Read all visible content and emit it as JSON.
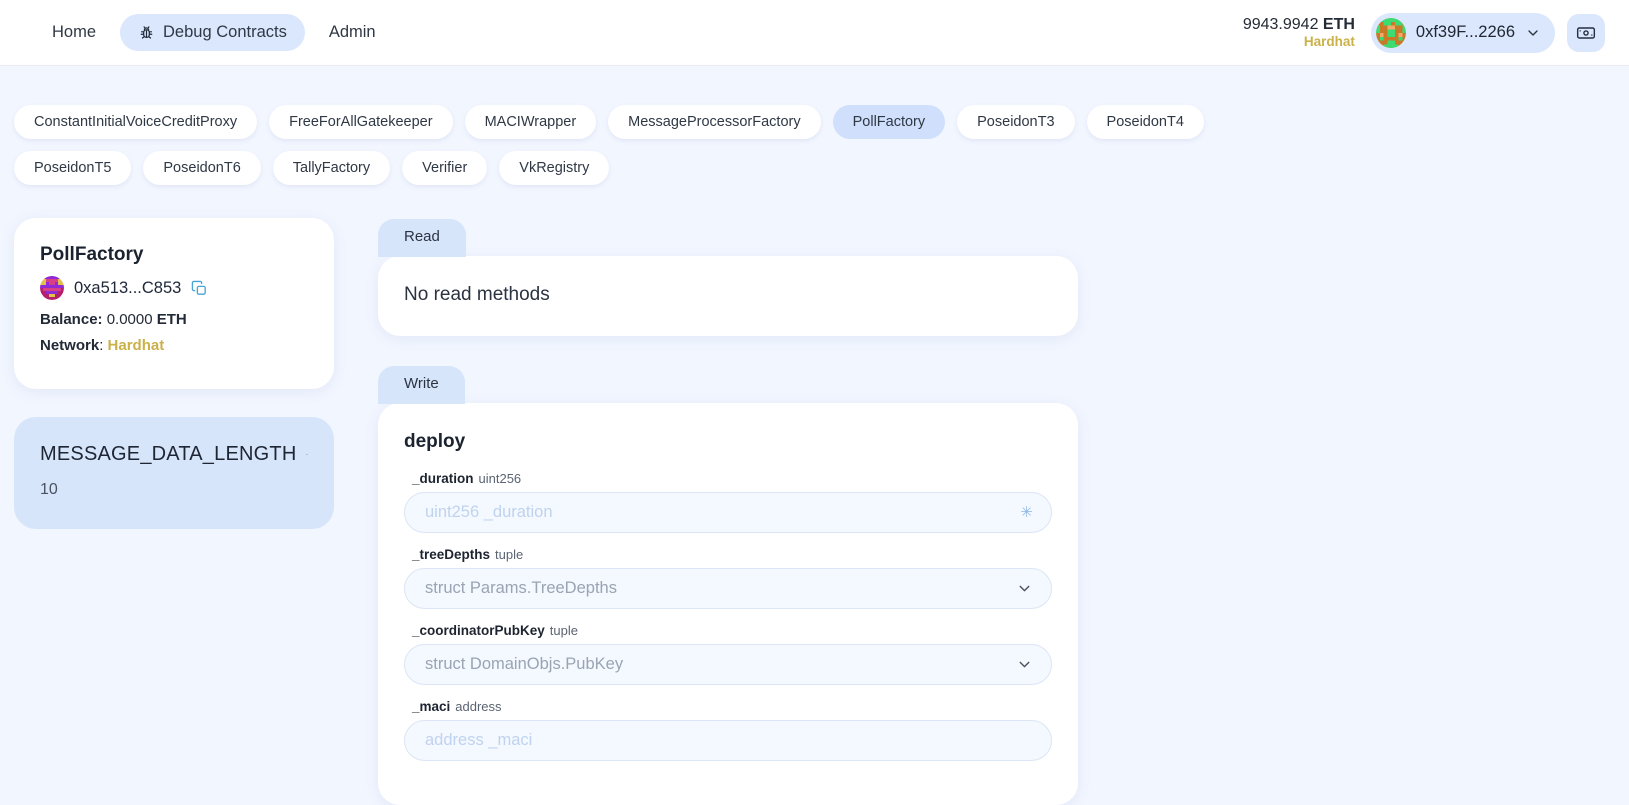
{
  "header": {
    "nav": [
      {
        "label": "Home",
        "icon": "",
        "active": false
      },
      {
        "label": "Debug Contracts",
        "icon": "bug-icon",
        "active": true
      },
      {
        "label": "Admin",
        "icon": "",
        "active": false
      }
    ],
    "balance_amount": "9943.9942",
    "balance_unit": "ETH",
    "network": "Hardhat",
    "account_address": "0xf39F...2266",
    "faucet_icon": "banknote-icon",
    "chevron_icon": "chevron-down-icon",
    "accent_blue": "#dbe7fd",
    "network_color": "#cbb14a"
  },
  "contract_tabs": [
    {
      "label": "ConstantInitialVoiceCreditProxy",
      "active": false
    },
    {
      "label": "FreeForAllGatekeeper",
      "active": false
    },
    {
      "label": "MACIWrapper",
      "active": false
    },
    {
      "label": "MessageProcessorFactory",
      "active": false
    },
    {
      "label": "PollFactory",
      "active": true
    },
    {
      "label": "PoseidonT3",
      "active": false
    },
    {
      "label": "PoseidonT4",
      "active": false
    },
    {
      "label": "PoseidonT5",
      "active": false
    },
    {
      "label": "PoseidonT6",
      "active": false
    },
    {
      "label": "TallyFactory",
      "active": false
    },
    {
      "label": "Verifier",
      "active": false
    },
    {
      "label": "VkRegistry",
      "active": false
    }
  ],
  "sidebar": {
    "contract_name": "PollFactory",
    "address": "0xa513...C853",
    "copy_icon": "copy-icon",
    "balance_label": "Balance:",
    "balance_value": "0.0000",
    "balance_unit": "ETH",
    "network_label": "Network",
    "network_value": "Hardhat",
    "variable": {
      "name": "MESSAGE_DATA_LENGTH",
      "refresh_icon": "refresh-icon",
      "value": "10"
    }
  },
  "read_section": {
    "tab_label": "Read",
    "empty_message": "No read methods"
  },
  "write_section": {
    "tab_label": "Write",
    "function_name": "deploy",
    "fields": [
      {
        "name": "_duration",
        "type": "uint256",
        "placeholder": "uint256 _duration",
        "value": "",
        "control": "text",
        "suffix_icon": "asterisk-icon"
      },
      {
        "name": "_treeDepths",
        "type": "tuple",
        "placeholder": "struct Params.TreeDepths",
        "value": "",
        "control": "select",
        "suffix_icon": "chevron-down-icon"
      },
      {
        "name": "_coordinatorPubKey",
        "type": "tuple",
        "placeholder": "struct DomainObjs.PubKey",
        "value": "",
        "control": "select",
        "suffix_icon": "chevron-down-icon"
      },
      {
        "name": "_maci",
        "type": "address",
        "placeholder": "address _maci",
        "value": "",
        "control": "text",
        "suffix_icon": ""
      }
    ]
  }
}
